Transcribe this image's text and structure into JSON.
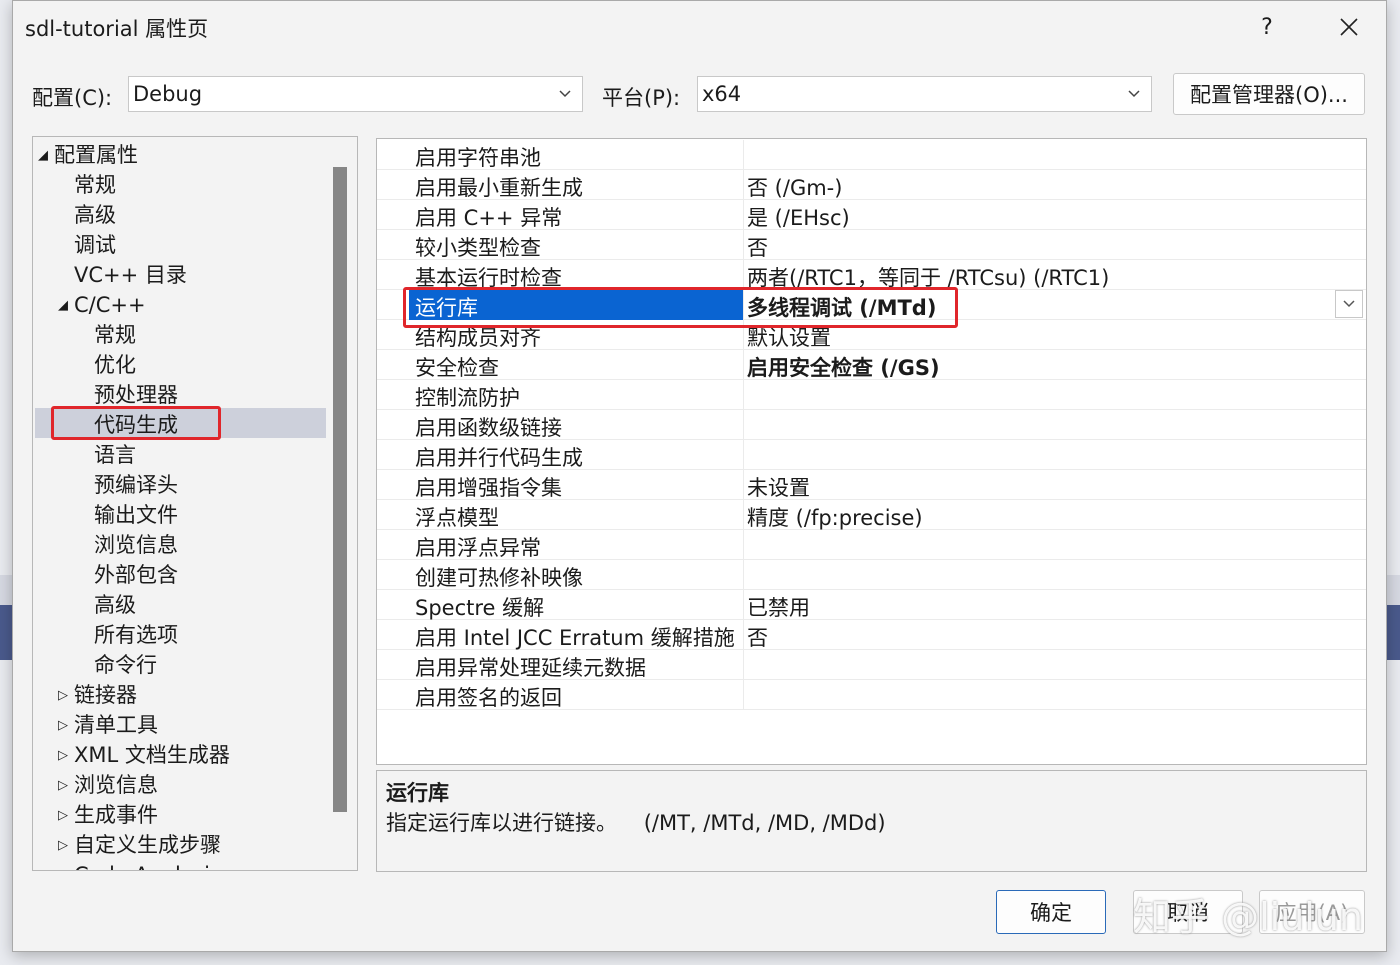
{
  "window": {
    "title": "sdl-tutorial 属性页",
    "help_label": "?",
    "close_label": "✕"
  },
  "toolbar": {
    "config_label": "配置(C):",
    "config_value": "Debug",
    "platform_label": "平台(P):",
    "platform_value": "x64",
    "config_manager_label": "配置管理器(O)..."
  },
  "tree": {
    "items": [
      {
        "label": "配置属性",
        "arrow": "◢"
      },
      {
        "label": "常规"
      },
      {
        "label": "高级"
      },
      {
        "label": "调试"
      },
      {
        "label": "VC++ 目录"
      },
      {
        "label": "C/C++",
        "arrow": "◢"
      },
      {
        "label": "常规"
      },
      {
        "label": "优化"
      },
      {
        "label": "预处理器"
      },
      {
        "label": "代码生成"
      },
      {
        "label": "语言"
      },
      {
        "label": "预编译头"
      },
      {
        "label": "输出文件"
      },
      {
        "label": "浏览信息"
      },
      {
        "label": "外部包含"
      },
      {
        "label": "高级"
      },
      {
        "label": "所有选项"
      },
      {
        "label": "命令行"
      },
      {
        "label": "链接器",
        "arrow": "▷"
      },
      {
        "label": "清单工具",
        "arrow": "▷"
      },
      {
        "label": "XML 文档生成器",
        "arrow": "▷"
      },
      {
        "label": "浏览信息",
        "arrow": "▷"
      },
      {
        "label": "生成事件",
        "arrow": "▷"
      },
      {
        "label": "自定义生成步骤",
        "arrow": "▷"
      },
      {
        "label": "Code Analysis",
        "arrow": "▷"
      }
    ]
  },
  "grid": {
    "rows": [
      {
        "name": "启用字符串池",
        "value": ""
      },
      {
        "name": "启用最小重新生成",
        "value": "否 (/Gm-)"
      },
      {
        "name": "启用 C++ 异常",
        "value": "是 (/EHsc)"
      },
      {
        "name": "较小类型检查",
        "value": "否"
      },
      {
        "name": "基本运行时检查",
        "value": "两者(/RTC1，等同于 /RTCsu) (/RTC1)"
      },
      {
        "name": "运行库",
        "value": "多线程调试 (/MTd)"
      },
      {
        "name": "结构成员对齐",
        "value": "默认设置"
      },
      {
        "name": "安全检查",
        "value": "启用安全检查 (/GS)"
      },
      {
        "name": "控制流防护",
        "value": ""
      },
      {
        "name": "启用函数级链接",
        "value": ""
      },
      {
        "name": "启用并行代码生成",
        "value": ""
      },
      {
        "name": "启用增强指令集",
        "value": "未设置"
      },
      {
        "name": "浮点模型",
        "value": "精度 (/fp:precise)"
      },
      {
        "name": "启用浮点异常",
        "value": ""
      },
      {
        "name": "创建可热修补映像",
        "value": ""
      },
      {
        "name": "Spectre 缓解",
        "value": "已禁用"
      },
      {
        "name": "启用 Intel JCC Erratum 缓解措施",
        "value": "否"
      },
      {
        "name": "启用异常处理延续元数据",
        "value": ""
      },
      {
        "name": "启用签名的返回",
        "value": ""
      }
    ]
  },
  "description": {
    "title": "运行库",
    "text": "指定运行库以进行链接。    (/MT, /MTd, /MD, /MDd)"
  },
  "buttons": {
    "ok": "确定",
    "cancel": "取消",
    "apply": "应用(A)"
  },
  "watermark": "知乎 @liulun",
  "colors": {
    "selection": "#0a64d2",
    "highlight_box": "#e0262b",
    "tree_selection": "#cdd0db"
  }
}
